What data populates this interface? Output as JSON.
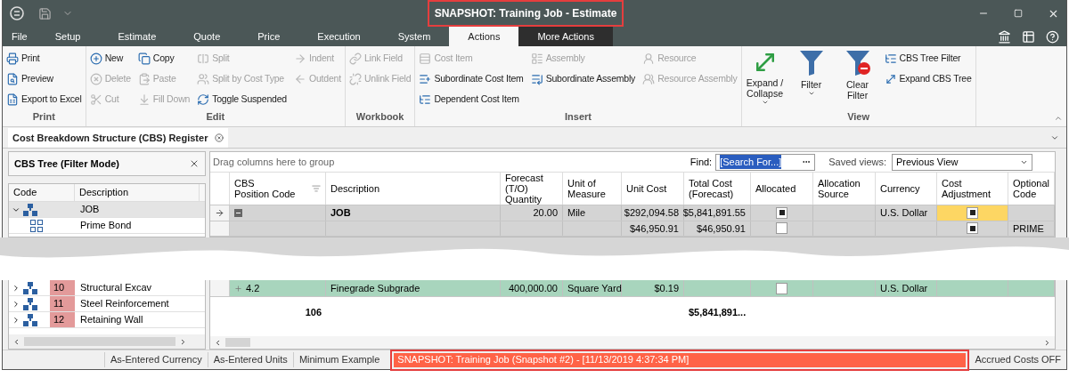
{
  "window": {
    "title": "SNAPSHOT: Training Job - Estimate"
  },
  "menu_tabs": [
    {
      "label": "File",
      "selected": false,
      "contextual": false
    },
    {
      "label": "Setup",
      "selected": false,
      "contextual": false
    },
    {
      "label": "Estimate",
      "selected": false,
      "contextual": false
    },
    {
      "label": "Quote",
      "selected": false,
      "contextual": false
    },
    {
      "label": "Price",
      "selected": false,
      "contextual": false
    },
    {
      "label": "Execution",
      "selected": false,
      "contextual": false
    },
    {
      "label": "System",
      "selected": false,
      "contextual": false
    },
    {
      "label": "Actions",
      "selected": true,
      "contextual": false
    },
    {
      "label": "More Actions",
      "selected": false,
      "contextual": true
    }
  ],
  "ribbon": [
    {
      "label": "Print",
      "columns": [
        [
          {
            "label": "Print",
            "disabled": false
          },
          {
            "label": "Preview",
            "disabled": false
          },
          {
            "label": "Export to Excel",
            "disabled": false
          }
        ]
      ]
    },
    {
      "label": "Edit",
      "columns": [
        [
          {
            "label": "New",
            "disabled": false
          },
          {
            "label": "Delete",
            "disabled": true
          },
          {
            "label": "Cut",
            "disabled": true
          }
        ],
        [
          {
            "label": "Copy",
            "disabled": false
          },
          {
            "label": "Paste",
            "disabled": true
          },
          {
            "label": "Fill Down",
            "disabled": true
          }
        ],
        [
          {
            "label": "Split",
            "disabled": true
          },
          {
            "label": "Split by Cost Type",
            "disabled": true
          },
          {
            "label": "Toggle Suspended",
            "disabled": false
          }
        ],
        [
          {
            "label": "Indent",
            "disabled": true
          },
          {
            "label": "Outdent",
            "disabled": true
          }
        ]
      ]
    },
    {
      "label": "Workbook",
      "columns": [
        [
          {
            "label": "Link Field",
            "disabled": true
          },
          {
            "label": "Unlink Field",
            "disabled": true
          }
        ]
      ]
    },
    {
      "label": "Insert",
      "columns": [
        [
          {
            "label": "Cost Item",
            "disabled": true
          },
          {
            "label": "Subordinate Cost Item",
            "disabled": false
          },
          {
            "label": "Dependent Cost Item",
            "disabled": false
          }
        ],
        [
          {
            "label": "Assembly",
            "disabled": true
          },
          {
            "label": "Subordinate Assembly",
            "disabled": false
          }
        ],
        [
          {
            "label": "Resource",
            "disabled": true
          },
          {
            "label": "Resource Assembly",
            "disabled": true
          }
        ]
      ]
    },
    {
      "label": "View",
      "large": [
        {
          "label": "Expand /",
          "label2": "Collapse",
          "dropdown": true
        },
        {
          "label": "Filter",
          "dropdown": true
        },
        {
          "label": "Clear",
          "label2": "Filter",
          "dropdown": false
        }
      ],
      "columns": [
        [
          {
            "label": "CBS Tree Filter",
            "disabled": false
          },
          {
            "label": "Expand CBS Tree",
            "disabled": false
          }
        ]
      ]
    }
  ],
  "document_tab": {
    "label": "Cost Breakdown Structure (CBS) Register"
  },
  "tree_panel": {
    "title": "CBS Tree (Filter Mode)",
    "columns": [
      "Code",
      "Description"
    ],
    "top_rows": [
      {
        "description": "JOB",
        "expanded": true,
        "kind": "group",
        "selected": true
      },
      {
        "description": "Prime Bond",
        "kind": "item",
        "selected": false
      }
    ],
    "bottom_rows": [
      {
        "code": "10",
        "description": "Structural Excav",
        "expanded": false,
        "kind": "group",
        "color": "#e39a9a",
        "selected": false
      },
      {
        "code": "11",
        "description": "Steel Reinforcement",
        "expanded": false,
        "kind": "group",
        "color": "#e39a9a",
        "selected": false
      },
      {
        "code": "12",
        "description": "Retaining Wall",
        "expanded": false,
        "kind": "group",
        "color": "#e39a9a",
        "selected": false
      }
    ]
  },
  "grid": {
    "group_hint": "Drag columns here to group",
    "find": {
      "label": "Find:",
      "value": "[Search For...]"
    },
    "saved_views": {
      "label": "Saved views:",
      "value": "Previous View"
    },
    "columns": [
      "CBS\nPosition Code",
      "Description",
      "Forecast\n(T/O)\nQuantity",
      "Unit of\nMeasure",
      "Unit Cost",
      "Total Cost\n(Forecast)",
      "Allocated",
      "Allocation\nSource",
      "Currency",
      "Cost\nAdjustment",
      "Optional\nCode"
    ],
    "top_rows": [
      {
        "current": true,
        "color": "#d4d4d4",
        "expanded": true,
        "description": "JOB",
        "quantity": "20.00",
        "unit": "Mile",
        "unit_cost": "$292,094.58",
        "total_cost": "$5,841,891.55",
        "allocated": true,
        "currency": "U.S. Dollar",
        "cost_adjustment": {
          "checked": true,
          "highlighted": true
        }
      },
      {
        "current": false,
        "color": "#d4d4d4",
        "unit_cost": "$46,950.91",
        "total_cost": "$46,950.91",
        "allocated": false,
        "cost_adjustment": {
          "checked": true,
          "highlighted": false
        },
        "optional_code": "PRIME"
      }
    ],
    "bottom_rows": [
      {
        "current": false,
        "color": "#a8d5bd",
        "position_code": "4.2",
        "description": "Finegrade Subgrade",
        "quantity": "400,000.00",
        "unit": "Square Yard",
        "unit_cost": "$0.19",
        "allocated": false,
        "currency": "U.S. Dollar"
      }
    ],
    "totals": {
      "position_code": "106",
      "total_cost": "$5,841,891..."
    }
  },
  "status_bar": {
    "items": [
      "As-Entered Currency",
      "As-Entered Units",
      "Minimum Example"
    ],
    "snapshot": "SNAPSHOT: Training Job (Snapshot #2) - [11/13/2019 4:37:34 PM]",
    "right": "Accrued Costs OFF"
  }
}
